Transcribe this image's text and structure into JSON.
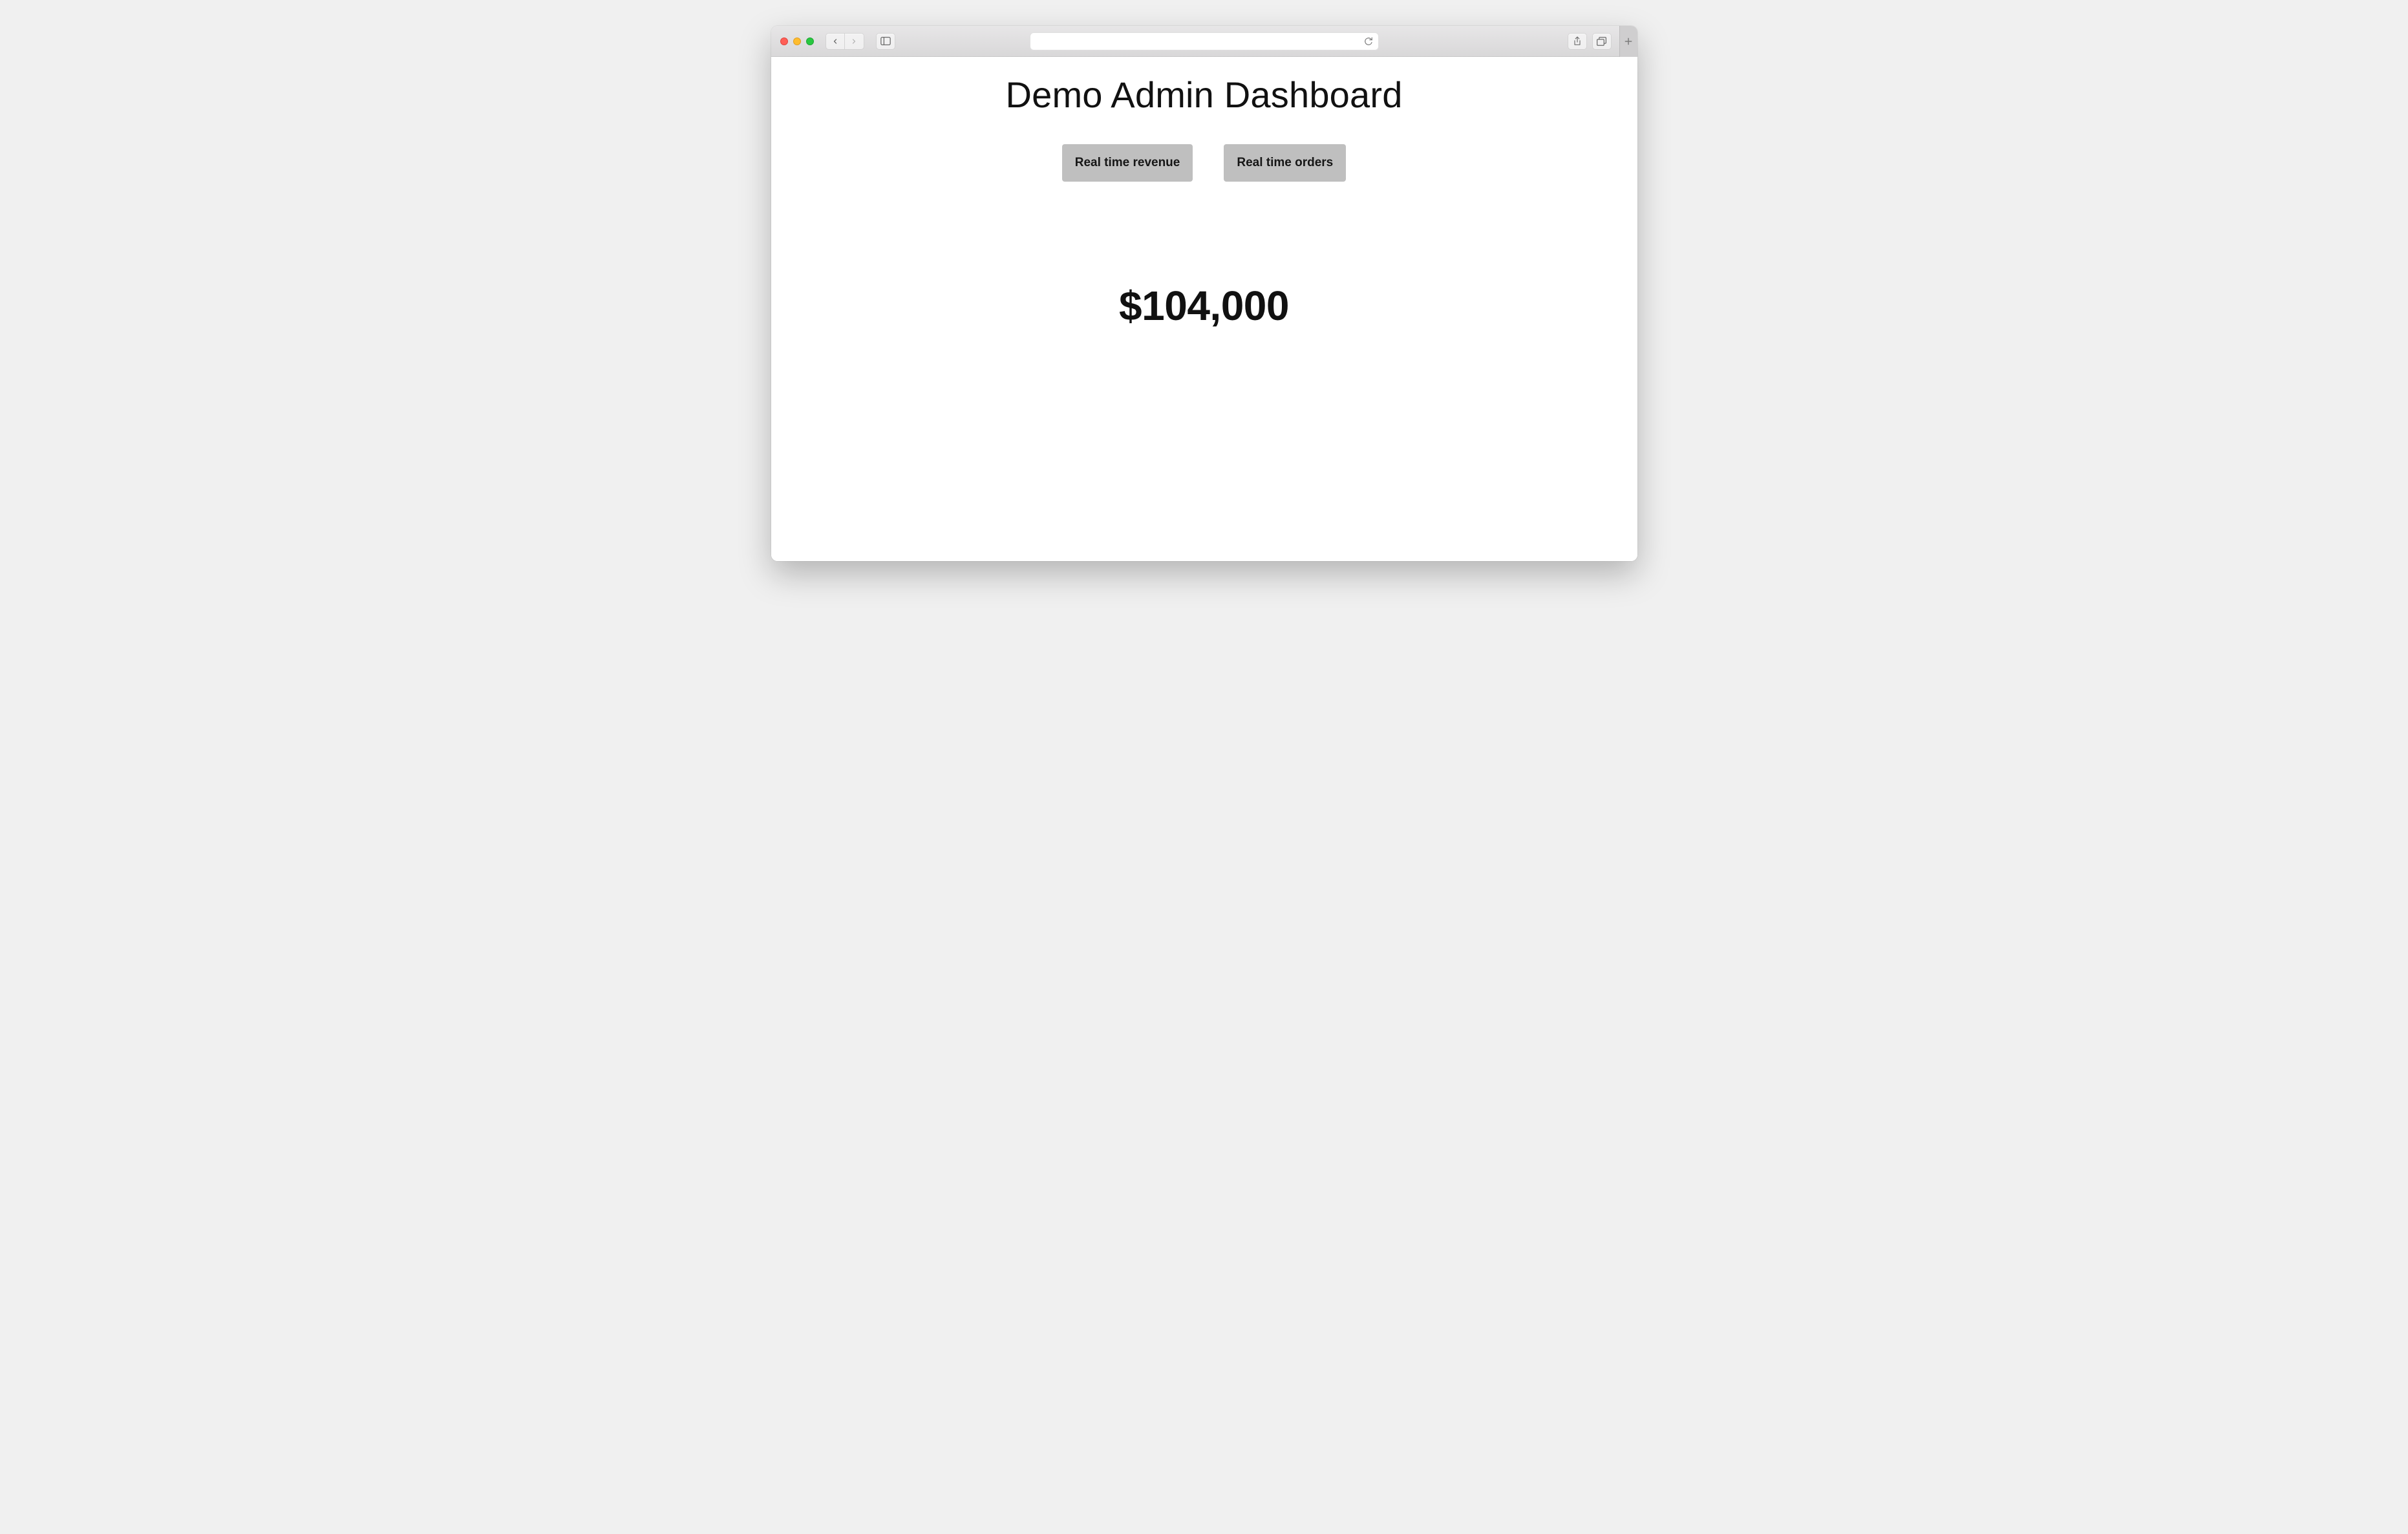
{
  "page": {
    "title": "Demo Admin Dashboard",
    "metric_value": "$104,000"
  },
  "buttons": {
    "revenue_label": "Real time revenue",
    "orders_label": "Real time orders"
  },
  "browser": {
    "url_value": ""
  }
}
